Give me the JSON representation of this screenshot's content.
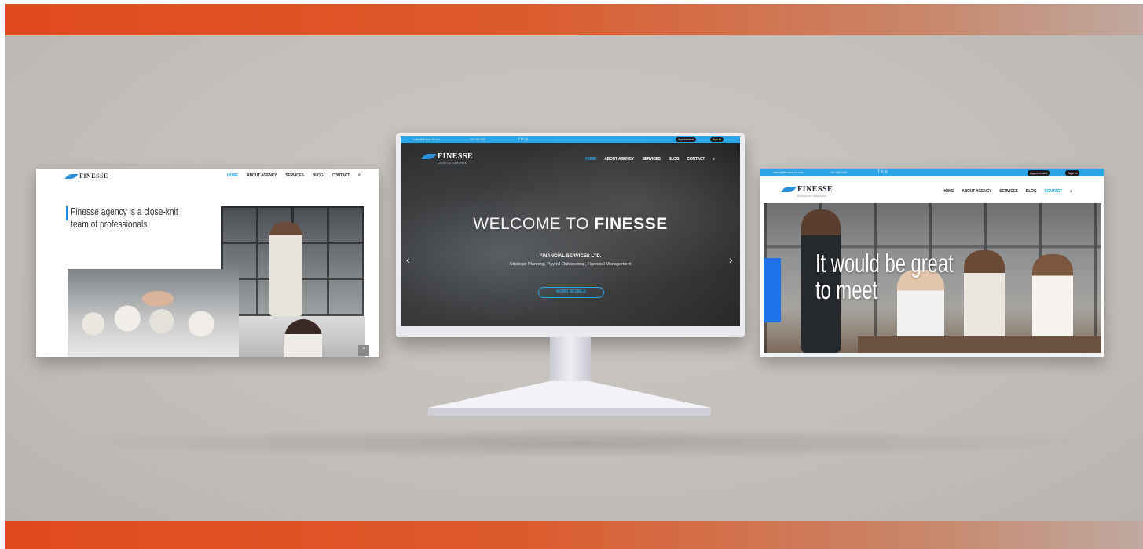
{
  "left_screen": {
    "logo": "FINESSE",
    "menu": [
      "HOME",
      "ABOUT AGENCY",
      "SERVICES",
      "BLOG",
      "CONTACT"
    ],
    "headline": "Finesse agency is a close-knit team of professionals",
    "scroll_top": "^"
  },
  "center_screen": {
    "topbar_left": [
      "sales@finesse-fs.com",
      "+44 000 000"
    ],
    "topbar_right": [
      "Appointment",
      "Sign In"
    ],
    "logo": "FINESSE",
    "logo_sub": "FINANCIAL SERVICES",
    "menu": [
      "HOME",
      "ABOUT AGENCY",
      "SERVICES",
      "BLOG",
      "CONTACT"
    ],
    "title_light": "WELCOME TO",
    "title_bold": "FINESSE",
    "subtitle": "FINANCIAL SERVICES LTD.",
    "tagline": "Strategic Planning, Payroll Outsourcing, Financial Management",
    "button": "MORE DETAILS",
    "prev": "‹",
    "next": "›"
  },
  "right_screen": {
    "topbar_left": [
      "sales@finesse-fs.com",
      "+44 000 000"
    ],
    "topbar_right": [
      "Appointment",
      "Sign In"
    ],
    "logo": "FINESSE",
    "logo_sub": "FINANCIAL SERVICES",
    "menu": [
      "HOME",
      "ABOUT AGENCY",
      "SERVICES",
      "BLOG",
      "CONTACT"
    ],
    "headline_line1": "It would be great",
    "headline_line2": "to meet"
  },
  "colors": {
    "accent": "#2ca4e6",
    "band": "#e1491f"
  }
}
